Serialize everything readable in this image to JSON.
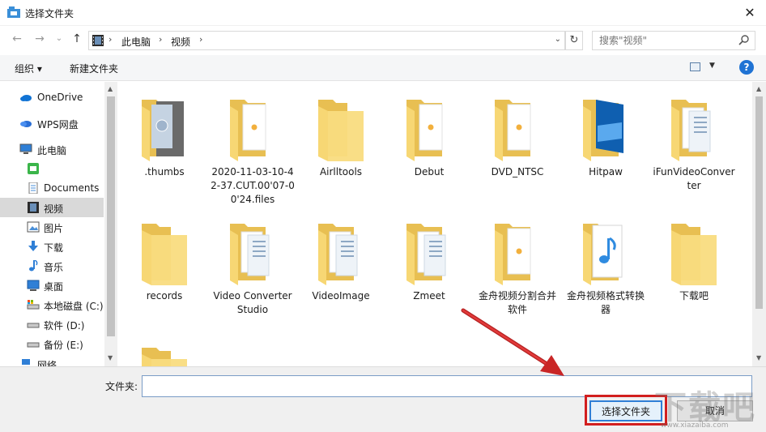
{
  "window": {
    "title": "选择文件夹",
    "close_glyph": "✕"
  },
  "address": {
    "crumbs": [
      "此电脑",
      "视频"
    ],
    "separator": "›",
    "dropdown_glyph": "⌄",
    "refresh_glyph": "↻",
    "search_placeholder": "搜索\"视频\""
  },
  "nav": {
    "back": "←",
    "forward": "→",
    "recent": "⌄",
    "up": "↑"
  },
  "toolbar": {
    "organize": "组织 ▾",
    "new_folder": "新建文件夹",
    "help": "?"
  },
  "sidebar": {
    "items": [
      {
        "label": "OneDrive",
        "icon": "onedrive-icon"
      },
      {
        "label": "WPS网盘",
        "icon": "wps-cloud-icon"
      },
      {
        "label": "此电脑",
        "icon": "computer-icon"
      },
      {
        "label": "",
        "icon": "green-app-icon"
      },
      {
        "label": "Documents",
        "icon": "documents-icon"
      },
      {
        "label": "视频",
        "icon": "video-icon",
        "selected": true
      },
      {
        "label": "图片",
        "icon": "pictures-icon"
      },
      {
        "label": "下载",
        "icon": "download-icon"
      },
      {
        "label": "音乐",
        "icon": "music-icon"
      },
      {
        "label": "桌面",
        "icon": "desktop-icon"
      },
      {
        "label": "本地磁盘 (C:)",
        "icon": "drive-c-icon"
      },
      {
        "label": "软件 (D:)",
        "icon": "drive-d-icon"
      },
      {
        "label": "备份 (E:)",
        "icon": "drive-e-icon"
      },
      {
        "label": "网络",
        "icon": "network-icon"
      }
    ]
  },
  "folders": [
    {
      "name": ".thumbs",
      "kind": "thumbs"
    },
    {
      "name": "2020-11-03-10-42-37.CUT.00'07-00'24.files",
      "kind": "paper"
    },
    {
      "name": "Airlltools",
      "kind": "plain"
    },
    {
      "name": "Debut",
      "kind": "paper"
    },
    {
      "name": "DVD_NTSC",
      "kind": "paper"
    },
    {
      "name": "Hitpaw",
      "kind": "windows"
    },
    {
      "name": "iFunVideoConverter",
      "kind": "docs"
    },
    {
      "name": "records",
      "kind": "plain"
    },
    {
      "name": "Video Converter Studio",
      "kind": "docs"
    },
    {
      "name": "VideoImage",
      "kind": "docs"
    },
    {
      "name": "Zmeet",
      "kind": "docs"
    },
    {
      "name": "金舟视频分割合并软件",
      "kind": "paper"
    },
    {
      "name": "金舟视频格式转换器",
      "kind": "music"
    },
    {
      "name": "下载吧",
      "kind": "plain"
    },
    {
      "name": "",
      "kind": "plain"
    }
  ],
  "bottom": {
    "folder_label": "文件夹:",
    "folder_value": "",
    "select_button": "选择文件夹",
    "cancel_button": "取消"
  },
  "watermark": {
    "text": "下载吧",
    "url": "www.xiazaiba.com"
  },
  "colors": {
    "highlight": "#d21e1e",
    "folder": "#f7d774",
    "accent": "#2f7fd6"
  }
}
